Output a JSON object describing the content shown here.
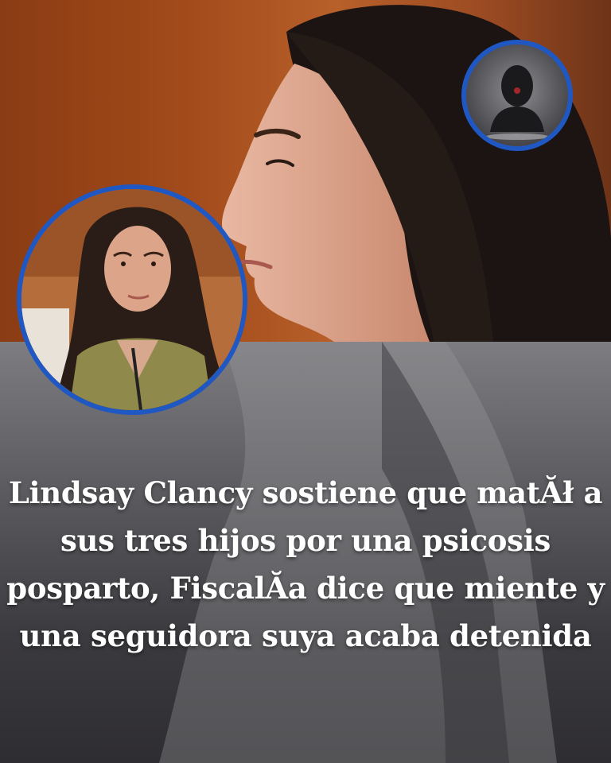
{
  "headline": "Lindsay Clancy sostiene que matĂł a sus tres hijos por una psicosis posparto, FiscalĂ­a dice que miente y una seguidora suya acaba detenida",
  "colors": {
    "ring_border": "#1f57c3",
    "headline_text": "#ffffff",
    "top_background": "#a24a1a",
    "bottom_background": "#5c5b5f"
  },
  "images": {
    "background_photo": "woman-profile-photo",
    "inset_photo": "woman-portrait-photo",
    "inset_silhouette": "anonymous-person-silhouette-icon"
  }
}
